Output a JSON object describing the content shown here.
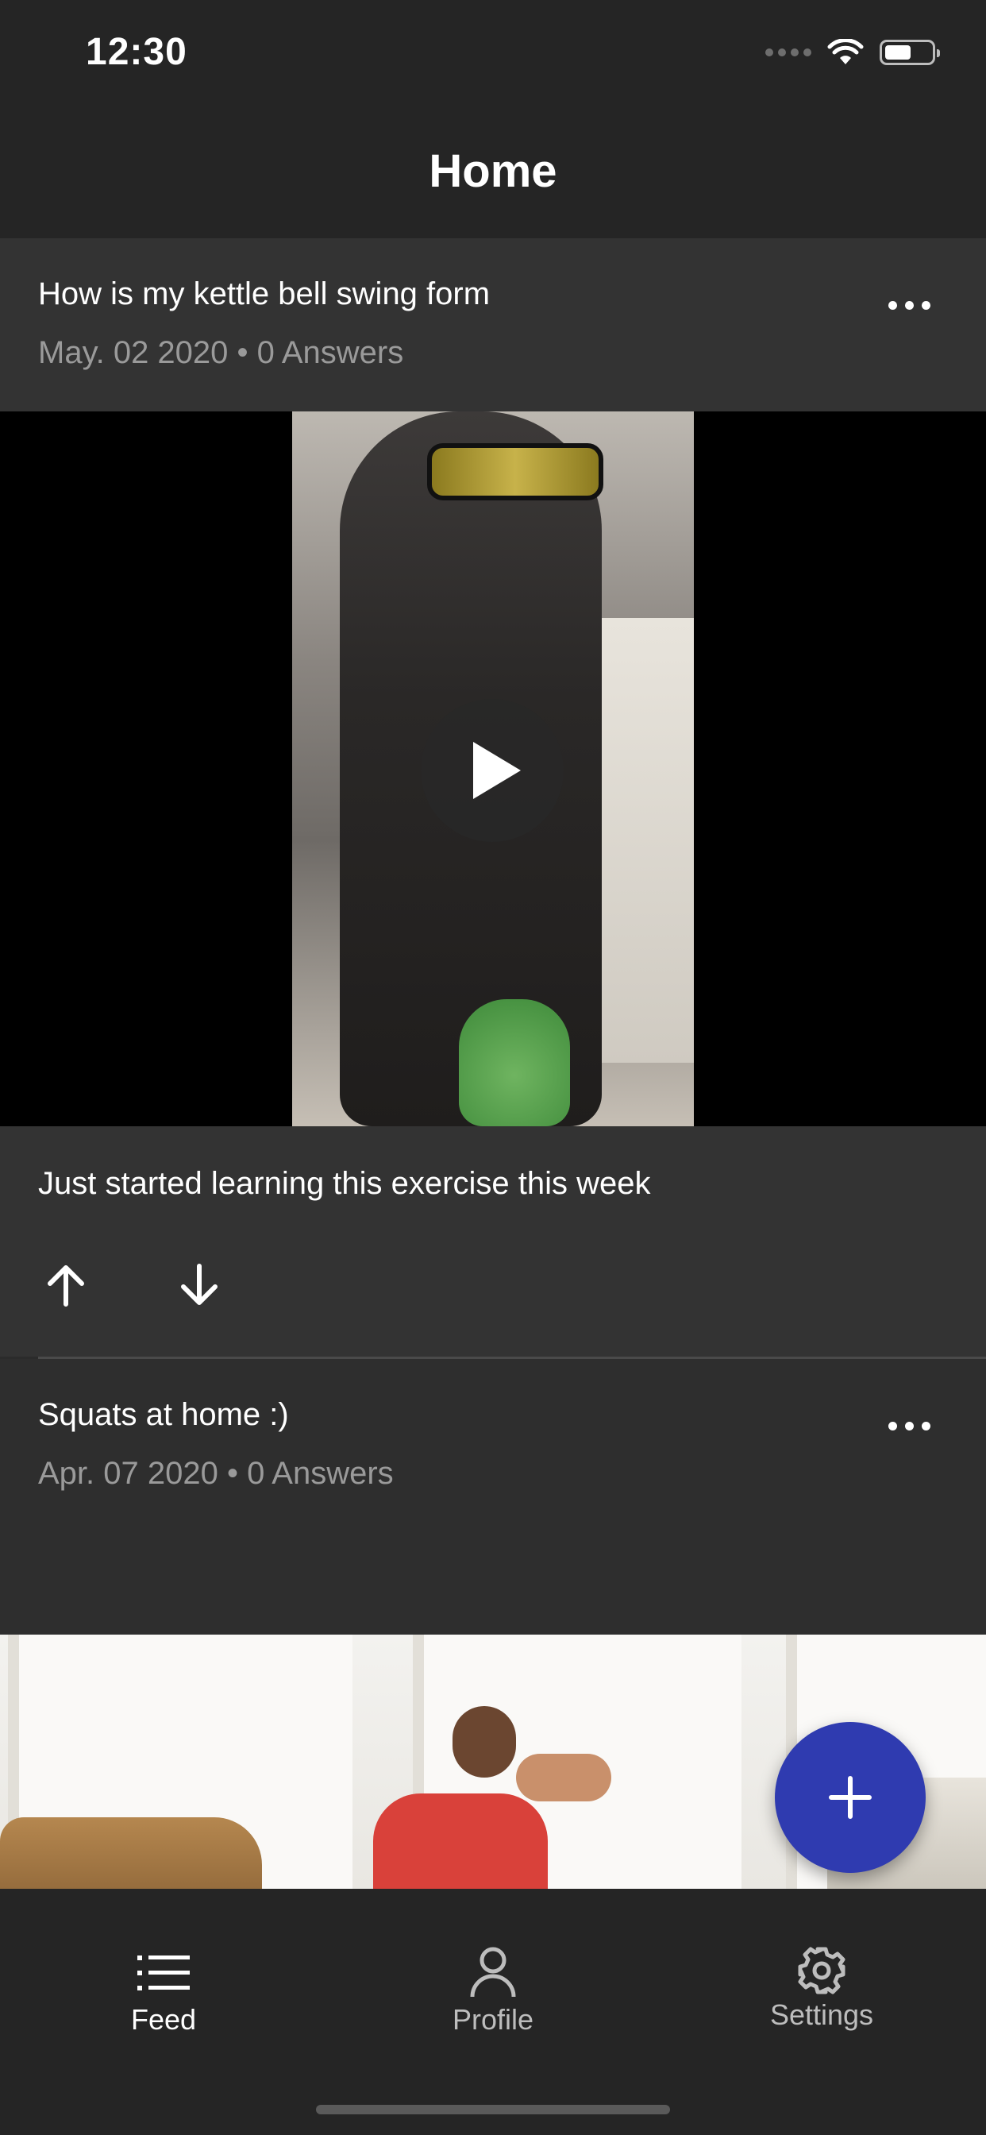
{
  "status_bar": {
    "time": "12:30"
  },
  "nav": {
    "title": "Home"
  },
  "posts": [
    {
      "title": "How is my kettle bell swing form",
      "date": "May. 02 2020",
      "answers": "0 Answers",
      "caption": "Just started learning this exercise this week"
    },
    {
      "title": "Squats at home :)",
      "date": "Apr. 07 2020",
      "answers": "0 Answers"
    }
  ],
  "tabs": [
    {
      "label": "Feed",
      "icon": "list-icon",
      "active": true
    },
    {
      "label": "Profile",
      "icon": "person-icon",
      "active": false
    },
    {
      "label": "Settings",
      "icon": "gear-icon",
      "active": false
    }
  ],
  "colors": {
    "fab": "#2f3bb0",
    "background": "#2b2b2b",
    "header": "#252525",
    "card": "#333333",
    "inactive_tab": "#bdbdbd"
  }
}
